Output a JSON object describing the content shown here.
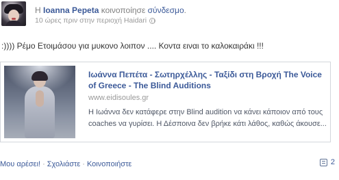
{
  "post": {
    "header": {
      "prefix": "Η",
      "author": "Ioanna Pepeta",
      "verb": "κοινοποίησε",
      "object_link": "σύνδεσμο",
      "period": "."
    },
    "meta": {
      "time_location": "10 ώρες πριν στην περιοχή Haidari",
      "privacy_icon": "globe-icon"
    },
    "message": ":)))) Ρέμο Ετοιμάσου για μυκονο λοιπον .... Κοντα ειναι το καλοκαιράκι !!!",
    "attachment": {
      "title": "Ιωάννα Πεπέτα - Σωτηρχέλλης - Ταξίδι στη Βροχή The Voice of Greece - The Blind Auditions",
      "source": "www.eidisoules.gr",
      "description_line1": "Η Ιωάννα δεν κατάφερε στην Blind audition να κάνει κάποιον από τους",
      "description_line2": "coaches να γυρίσει. Η Δέσποινα δεν βρήκε κάτι λάθος, καθώς άκουσε..."
    },
    "actions": {
      "like": "Μου αρέσει!",
      "comment": "Σχολιάστε",
      "share": "Κοινοποιήστε",
      "separator": "·"
    },
    "comments": {
      "count": "2",
      "icon": "comment-icon"
    }
  },
  "colors": {
    "link": "#3b5998",
    "muted": "#999999",
    "text": "#333333",
    "border": "#d3d6db"
  }
}
